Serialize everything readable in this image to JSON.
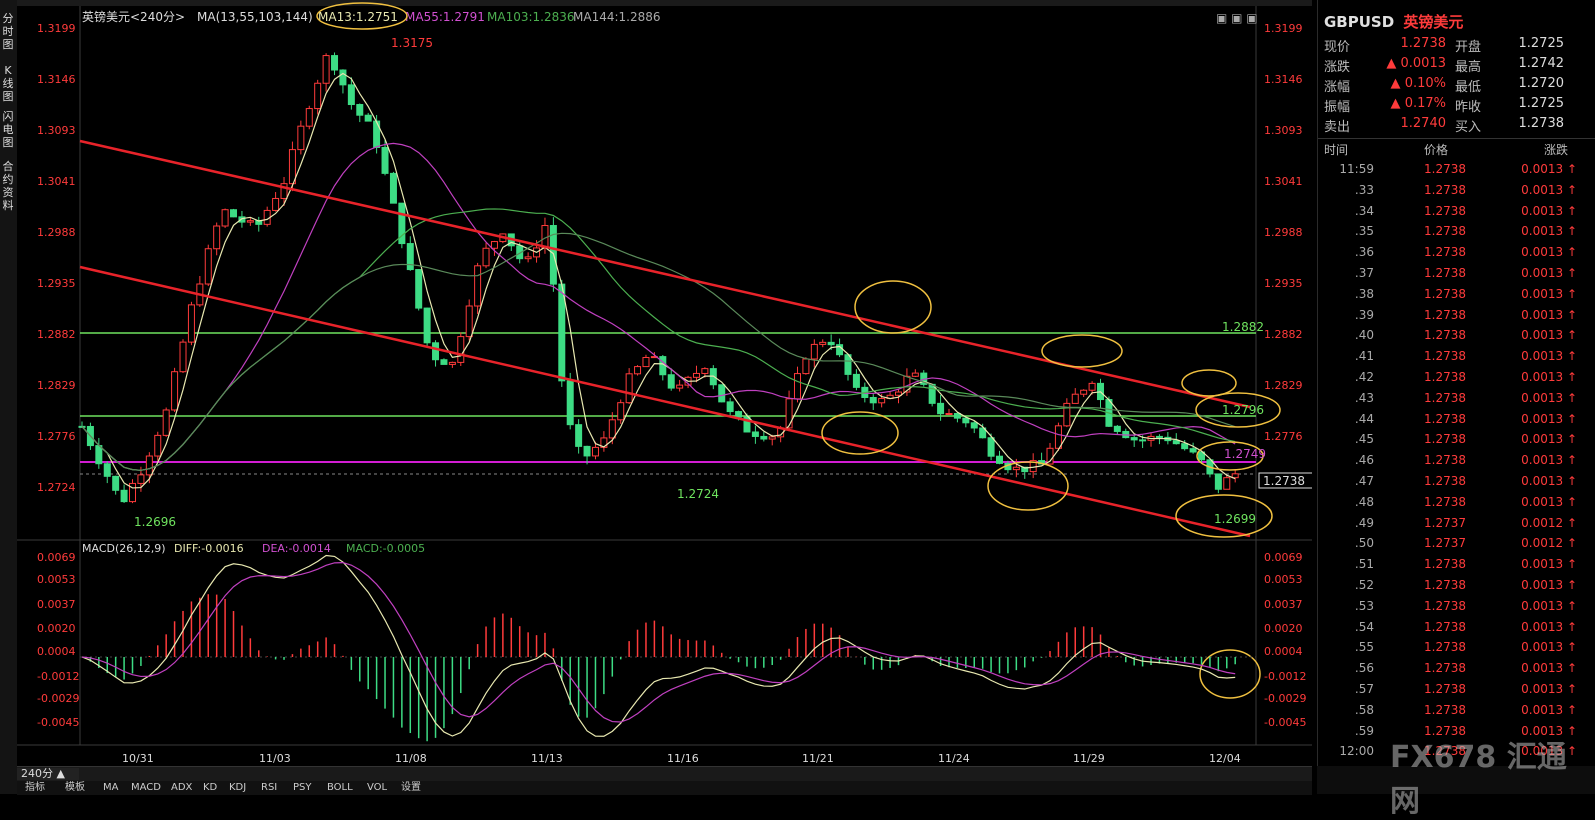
{
  "left_rail": {
    "tabs": [
      "分时图",
      "K线图",
      "闪电图",
      "合约资料"
    ]
  },
  "header": {
    "instrument_label": "英镑美元",
    "period_label": "<240分>",
    "ma_params": "MA(13,55,103,144)",
    "ma13": "MA13:1.2751",
    "ma55": "MA55:1.2791",
    "ma103": "MA103:1.2836",
    "ma144": "MA144:1.2886"
  },
  "price_axis": {
    "labels": [
      "1.3199",
      "1.3146",
      "1.3093",
      "1.3041",
      "1.2988",
      "1.2935",
      "1.2882",
      "1.2829",
      "1.2776",
      "1.2724"
    ]
  },
  "price_annotations": {
    "high": "1.3175",
    "low_left": "1.2696",
    "low_mid": "1.2724",
    "low_right": "1.2699",
    "level_green": "1.2882",
    "level_green2": "1.2796",
    "level_magenta": "1.2749",
    "current": "1.2738"
  },
  "macd": {
    "header": "MACD(26,12,9)",
    "diff": "DIFF:-0.0016",
    "dea": "DEA:-0.0014",
    "macd": "MACD:-0.0005",
    "axis": [
      "0.0069",
      "0.0053",
      "0.0037",
      "0.0020",
      "0.0004",
      "-0.0012",
      "-0.0029",
      "-0.0045"
    ]
  },
  "time_axis": {
    "labels": [
      "10/31",
      "11/03",
      "11/08",
      "11/13",
      "11/16",
      "11/21",
      "11/24",
      "11/29",
      "12/04"
    ]
  },
  "bottom": {
    "period": "240分 ▲",
    "tabs": [
      "指标",
      "模板",
      "MA",
      "MACD",
      "ADX",
      "KD",
      "KDJ",
      "RSI",
      "PSY",
      "BOLL",
      "VOL",
      "设置"
    ]
  },
  "quote": {
    "symbol": "GBPUSD",
    "name": "英镑美元",
    "rows": [
      {
        "l1": "现价",
        "v1": "1.2738",
        "l2": "开盘",
        "v2": "1.2725",
        "arrow": ""
      },
      {
        "l1": "涨跌",
        "v1": "0.0013",
        "l2": "最高",
        "v2": "1.2742",
        "arrow": "up"
      },
      {
        "l1": "涨幅",
        "v1": "0.10%",
        "l2": "最低",
        "v2": "1.2720",
        "arrow": "up"
      },
      {
        "l1": "振幅",
        "v1": "0.17%",
        "l2": "昨收",
        "v2": "1.2725",
        "arrow": "up"
      },
      {
        "l1": "卖出",
        "v1": "1.2740",
        "l2": "买入",
        "v2": "1.2738",
        "arrow": ""
      }
    ]
  },
  "ticks": {
    "header": {
      "time": "时间",
      "price": "价格",
      "chg": "涨跌"
    },
    "rows": [
      {
        "t": "11:59",
        "p": "1.2738",
        "c": "0.0013"
      },
      {
        "t": ".33",
        "p": "1.2738",
        "c": "0.0013"
      },
      {
        "t": ".34",
        "p": "1.2738",
        "c": "0.0013"
      },
      {
        "t": ".35",
        "p": "1.2738",
        "c": "0.0013"
      },
      {
        "t": ".36",
        "p": "1.2738",
        "c": "0.0013"
      },
      {
        "t": ".37",
        "p": "1.2738",
        "c": "0.0013"
      },
      {
        "t": ".38",
        "p": "1.2738",
        "c": "0.0013"
      },
      {
        "t": ".39",
        "p": "1.2738",
        "c": "0.0013"
      },
      {
        "t": ".40",
        "p": "1.2738",
        "c": "0.0013"
      },
      {
        "t": ".41",
        "p": "1.2738",
        "c": "0.0013"
      },
      {
        "t": ".42",
        "p": "1.2738",
        "c": "0.0013"
      },
      {
        "t": ".43",
        "p": "1.2738",
        "c": "0.0013"
      },
      {
        "t": ".44",
        "p": "1.2738",
        "c": "0.0013"
      },
      {
        "t": ".45",
        "p": "1.2738",
        "c": "0.0013"
      },
      {
        "t": ".46",
        "p": "1.2738",
        "c": "0.0013"
      },
      {
        "t": ".47",
        "p": "1.2738",
        "c": "0.0013"
      },
      {
        "t": ".48",
        "p": "1.2738",
        "c": "0.0013"
      },
      {
        "t": ".49",
        "p": "1.2737",
        "c": "0.0012"
      },
      {
        "t": ".50",
        "p": "1.2737",
        "c": "0.0012"
      },
      {
        "t": ".51",
        "p": "1.2738",
        "c": "0.0013"
      },
      {
        "t": ".52",
        "p": "1.2738",
        "c": "0.0013"
      },
      {
        "t": ".53",
        "p": "1.2738",
        "c": "0.0013"
      },
      {
        "t": ".54",
        "p": "1.2738",
        "c": "0.0013"
      },
      {
        "t": ".55",
        "p": "1.2738",
        "c": "0.0013"
      },
      {
        "t": ".56",
        "p": "1.2738",
        "c": "0.0013"
      },
      {
        "t": ".57",
        "p": "1.2738",
        "c": "0.0013"
      },
      {
        "t": ".58",
        "p": "1.2738",
        "c": "0.0013"
      },
      {
        "t": ".59",
        "p": "1.2738",
        "c": "0.0013"
      },
      {
        "t": "12:00",
        "p": "1.2738",
        "c": "0.0013"
      }
    ]
  },
  "watermark": "FX678 汇通网",
  "colors": {
    "up": "#ff3b3b",
    "down": "#3ddc84",
    "ma13": "#e8e8b0",
    "ma55": "#c040c0",
    "ma103": "#4caf50",
    "channel": "#e8232a",
    "level_green": "#6fe35f",
    "level_magenta": "#d21cd2",
    "annotation": "#f0c040"
  }
}
